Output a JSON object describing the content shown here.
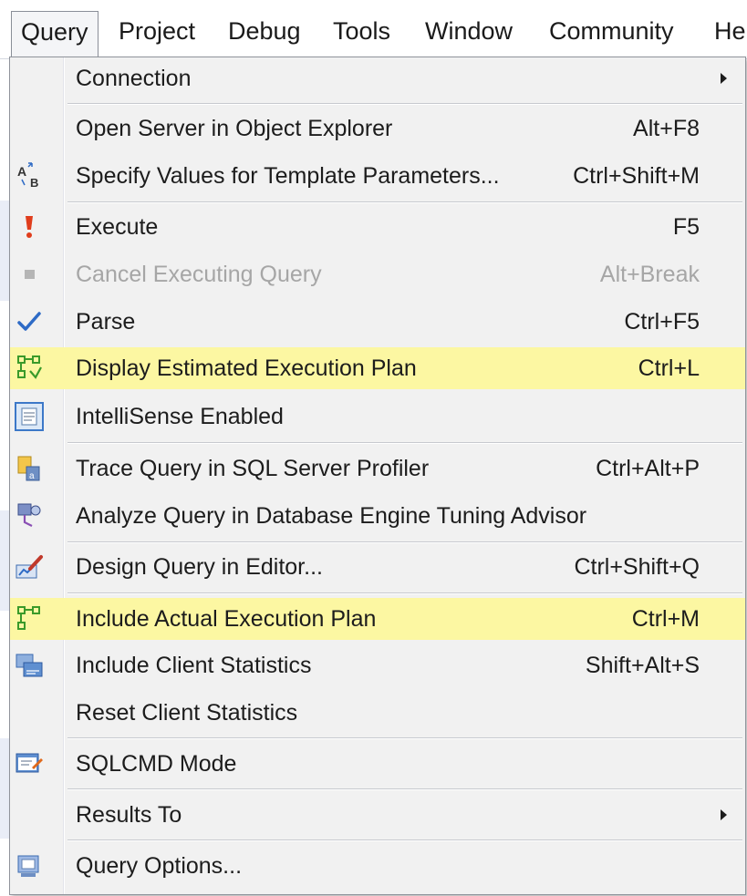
{
  "menubar": {
    "items": [
      "Query",
      "Project",
      "Debug",
      "Tools",
      "Window",
      "Community",
      "He"
    ]
  },
  "menu": {
    "items": [
      {
        "label": "Connection",
        "shortcut": "",
        "submenu": true,
        "icon": ""
      },
      {
        "label": "Open Server in Object Explorer",
        "shortcut": "Alt+F8",
        "icon": ""
      },
      {
        "label": "Specify Values for Template Parameters...",
        "shortcut": "Ctrl+Shift+M",
        "icon": "template-params-icon"
      },
      {
        "label": "Execute",
        "shortcut": "F5",
        "icon": "execute-icon"
      },
      {
        "label": "Cancel Executing Query",
        "shortcut": "Alt+Break",
        "icon": "cancel-icon",
        "disabled": true
      },
      {
        "label": "Parse",
        "shortcut": "Ctrl+F5",
        "icon": "parse-checkmark-icon"
      },
      {
        "label": "Display Estimated Execution Plan",
        "shortcut": "Ctrl+L",
        "icon": "estimated-plan-icon",
        "highlighted": true
      },
      {
        "label": "IntelliSense Enabled",
        "shortcut": "",
        "icon": "intellisense-icon"
      },
      {
        "label": "Trace Query in SQL Server Profiler",
        "shortcut": "Ctrl+Alt+P",
        "icon": "profiler-icon"
      },
      {
        "label": "Analyze Query in Database Engine Tuning Advisor",
        "shortcut": "",
        "icon": "tuning-advisor-icon"
      },
      {
        "label": "Design Query in Editor...",
        "shortcut": "Ctrl+Shift+Q",
        "icon": "design-query-icon"
      },
      {
        "label": "Include Actual Execution Plan",
        "shortcut": "Ctrl+M",
        "icon": "actual-plan-icon",
        "highlighted": true
      },
      {
        "label": "Include Client Statistics",
        "shortcut": "Shift+Alt+S",
        "icon": "client-statistics-icon"
      },
      {
        "label": "Reset Client Statistics",
        "shortcut": "",
        "icon": ""
      },
      {
        "label": "SQLCMD Mode",
        "shortcut": "",
        "icon": "sqlcmd-icon"
      },
      {
        "label": "Results To",
        "shortcut": "",
        "submenu": true,
        "icon": ""
      },
      {
        "label": "Query Options...",
        "shortcut": "",
        "icon": "query-options-icon"
      }
    ]
  },
  "colors": {
    "highlight": "#fcf7a2",
    "disabled_text": "#a6a6a6",
    "accent_blue": "#2e6bc6"
  }
}
